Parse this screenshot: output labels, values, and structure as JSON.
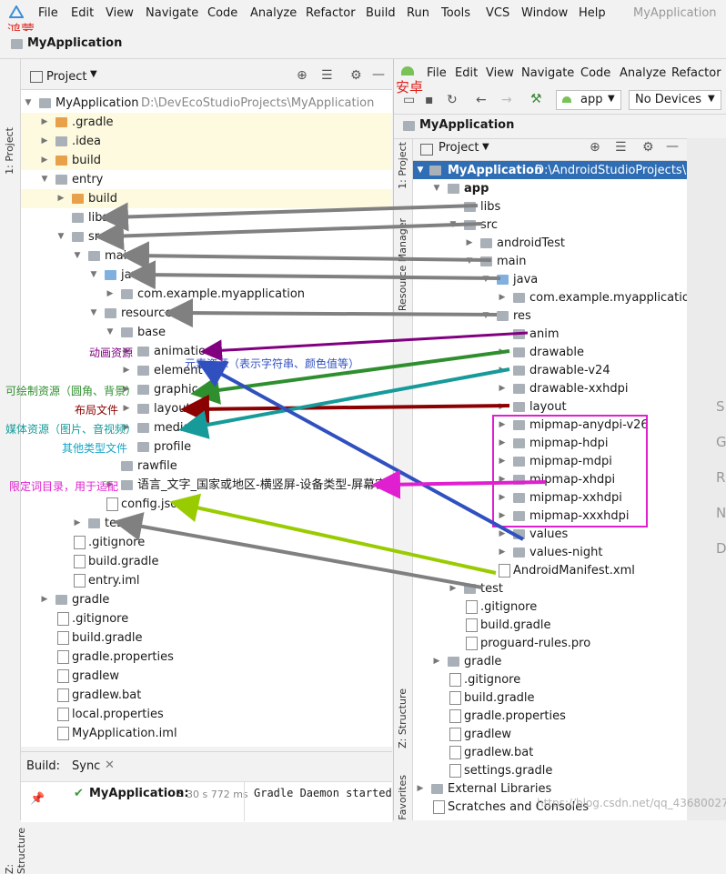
{
  "hm": {
    "menu": [
      "File",
      "Edit",
      "View",
      "Navigate",
      "Code",
      "Analyze",
      "Refactor",
      "Build",
      "Run",
      "Tools",
      "VCS",
      "Window",
      "Help"
    ],
    "title_right": "MyApplication",
    "label": "鸿蒙",
    "project_crumb": "MyApplication",
    "panel_title": "Project",
    "side_tab": "1: Project",
    "structure_tab": "Z: Structure",
    "tree": {
      "root": "MyApplication",
      "root_path": "D:\\DevEcoStudioProjects\\MyApplication",
      "items": [
        ".gradle",
        ".idea",
        "build",
        "entry",
        "build",
        "libs",
        "src",
        "main",
        "java",
        "com.example.myapplication",
        "resources",
        "base",
        "animation",
        "element",
        "graphic",
        "layout",
        "media",
        "profile",
        "rawfile",
        "语言_文字_国家或地区-横竖屏-设备类型-屏幕密度",
        "config.json",
        "test",
        ".gitignore",
        "build.gradle",
        "entry.iml",
        "gradle",
        ".gitignore",
        "build.gradle",
        "gradle.properties",
        "gradlew",
        "gradlew.bat",
        "local.properties",
        "MyApplication.iml"
      ]
    },
    "build_bar": {
      "build": "Build:",
      "sync": "Sync",
      "task": "MyApplication:",
      "task_suffix": "s",
      "time": "30 s 772 ms",
      "log": "Gradle Daemon started"
    }
  },
  "as": {
    "menu": [
      "File",
      "Edit",
      "View",
      "Navigate",
      "Code",
      "Analyze",
      "Refactor"
    ],
    "label": "安卓",
    "run_config": "app",
    "devices": "No Devices",
    "project_crumb": "MyApplication",
    "panel_title": "Project",
    "side_tabs": [
      "1: Project",
      "Resource Manager",
      "Z: Structure",
      "Favorites"
    ],
    "tree": {
      "root": "MyApplication",
      "root_path": "D:\\AndroidStudioProjects\\Pr",
      "items": [
        "app",
        "libs",
        "src",
        "androidTest",
        "main",
        "java",
        "com.example.myapplication",
        "res",
        "anim",
        "drawable",
        "drawable-v24",
        "drawable-xxhdpi",
        "layout",
        "mipmap-anydpi-v26",
        "mipmap-hdpi",
        "mipmap-mdpi",
        "mipmap-xhdpi",
        "mipmap-xxhdpi",
        "mipmap-xxxhdpi",
        "values",
        "values-night",
        "AndroidManifest.xml",
        "test",
        ".gitignore",
        "build.gradle",
        "proguard-rules.pro",
        "gradle",
        ".gitignore",
        "build.gradle",
        "gradle.properties",
        "gradlew",
        "gradlew.bat",
        "settings.gradle",
        "External Libraries",
        "Scratches and Consoles"
      ]
    },
    "right_letters": [
      "S",
      "G",
      "R",
      "N",
      "D"
    ]
  },
  "annotations": {
    "animation": "动画资源",
    "element": "元素资源（表示字符串、颜色值等）",
    "graphic": "可绘制资源（圆角、背景）",
    "layout": "布局文件",
    "media": "媒体资源（图片、音视频）",
    "profile": "其他类型文件",
    "qualifier": "限定词目录，用于适配"
  },
  "watermark": "https://blog.csdn.net/qq_43680027"
}
